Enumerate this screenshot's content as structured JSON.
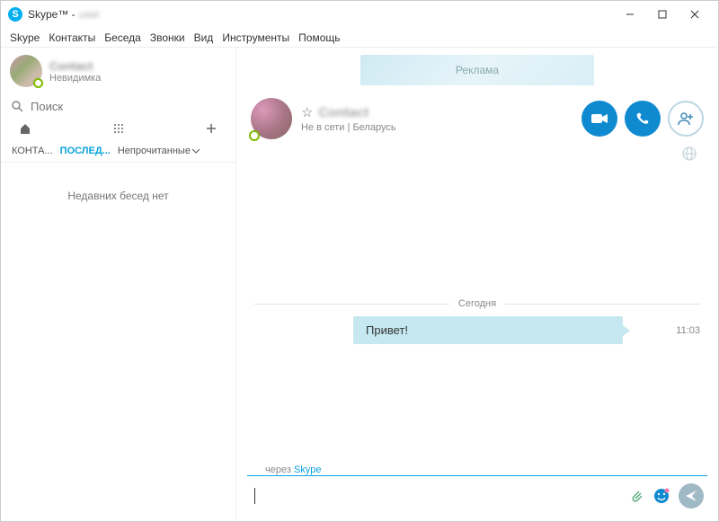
{
  "window": {
    "title": "Skype™ -",
    "title_extra": "user"
  },
  "menu": {
    "skype": "Skype",
    "contacts": "Контакты",
    "conversation": "Беседа",
    "calls": "Звонки",
    "view": "Вид",
    "tools": "Инструменты",
    "help": "Помощь"
  },
  "sidebar": {
    "profile": {
      "name": "Contact",
      "status": "Невидимка"
    },
    "search": {
      "placeholder": "Поиск"
    },
    "tabs": {
      "contacts": "КОНТА...",
      "recent": "ПОСЛЕД...",
      "filter": "Непрочитанные"
    },
    "empty": "Недавних бесед нет"
  },
  "chat": {
    "ad": "Реклама",
    "header": {
      "name": "Contact",
      "status": "Не в сети",
      "sep": " | ",
      "location": "Беларусь"
    },
    "divider": "Сегодня",
    "messages": [
      {
        "text": "Привет!",
        "time": "11:03"
      }
    ],
    "via_prefix": "через ",
    "via_link": "Skype",
    "input_placeholder": ""
  }
}
